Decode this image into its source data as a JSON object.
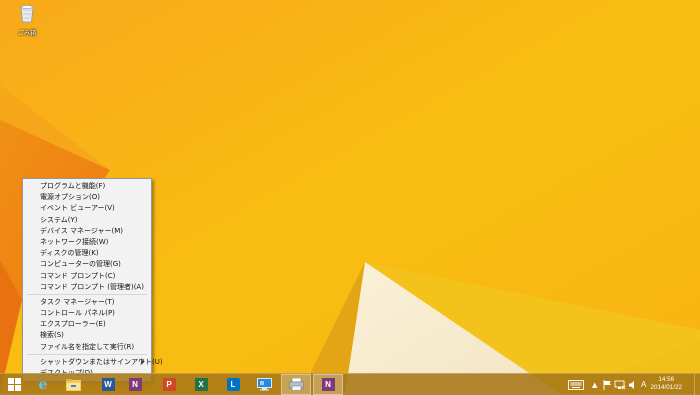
{
  "desktop": {
    "recycle_bin_label": "ごみ箱",
    "wallpaper_color": "#F7B615"
  },
  "context_menu": {
    "items": [
      {
        "label": "プログラムと機能(F)"
      },
      {
        "label": "電源オプション(O)"
      },
      {
        "label": "イベント ビューアー(V)"
      },
      {
        "label": "システム(Y)"
      },
      {
        "label": "デバイス マネージャー(M)"
      },
      {
        "label": "ネットワーク接続(W)"
      },
      {
        "label": "ディスクの管理(K)"
      },
      {
        "label": "コンピューターの管理(G)"
      },
      {
        "label": "コマンド プロンプト(C)"
      },
      {
        "label": "コマンド プロンプト (管理者)(A)"
      },
      {
        "label": "タスク マネージャー(T)"
      },
      {
        "label": "コントロール パネル(P)"
      },
      {
        "label": "エクスプローラー(E)"
      },
      {
        "label": "検索(S)"
      },
      {
        "label": "ファイル名を指定して実行(R)"
      },
      {
        "label": "シャットダウンまたはサインアウト(U)",
        "submenu_icon": "chevron-right-icon"
      },
      {
        "label": "デスクトップ(D)"
      }
    ]
  },
  "taskbar": {
    "apps": [
      {
        "icon": "windows-logo-icon"
      },
      {
        "icon": "internet-explorer-icon",
        "letter": "e"
      },
      {
        "icon": "file-explorer-icon"
      },
      {
        "icon": "word-icon",
        "letter": "W"
      },
      {
        "icon": "onenote-icon",
        "letter": "N"
      },
      {
        "icon": "powerpoint-icon",
        "letter": "P"
      },
      {
        "icon": "excel-icon",
        "letter": "X"
      },
      {
        "icon": "lync-icon",
        "letter": "L"
      },
      {
        "icon": "remote-desktop-icon"
      },
      {
        "icon": "printer-icon"
      },
      {
        "icon": "onenote-clipper-icon",
        "letter": "N"
      }
    ],
    "ime_indicator": "A",
    "clock": {
      "time": "14:56",
      "date": "2014/01/22"
    }
  }
}
